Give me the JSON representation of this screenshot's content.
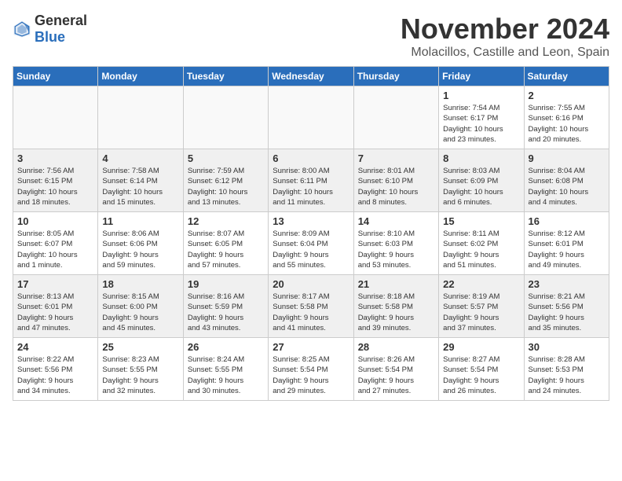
{
  "header": {
    "logo_general": "General",
    "logo_blue": "Blue",
    "month": "November 2024",
    "location": "Molacillos, Castille and Leon, Spain"
  },
  "weekdays": [
    "Sunday",
    "Monday",
    "Tuesday",
    "Wednesday",
    "Thursday",
    "Friday",
    "Saturday"
  ],
  "weeks": [
    [
      {
        "day": "",
        "info": "",
        "empty": true
      },
      {
        "day": "",
        "info": "",
        "empty": true
      },
      {
        "day": "",
        "info": "",
        "empty": true
      },
      {
        "day": "",
        "info": "",
        "empty": true
      },
      {
        "day": "",
        "info": "",
        "empty": true
      },
      {
        "day": "1",
        "info": "Sunrise: 7:54 AM\nSunset: 6:17 PM\nDaylight: 10 hours\nand 23 minutes.",
        "empty": false
      },
      {
        "day": "2",
        "info": "Sunrise: 7:55 AM\nSunset: 6:16 PM\nDaylight: 10 hours\nand 20 minutes.",
        "empty": false
      }
    ],
    [
      {
        "day": "3",
        "info": "Sunrise: 7:56 AM\nSunset: 6:15 PM\nDaylight: 10 hours\nand 18 minutes.",
        "empty": false
      },
      {
        "day": "4",
        "info": "Sunrise: 7:58 AM\nSunset: 6:14 PM\nDaylight: 10 hours\nand 15 minutes.",
        "empty": false
      },
      {
        "day": "5",
        "info": "Sunrise: 7:59 AM\nSunset: 6:12 PM\nDaylight: 10 hours\nand 13 minutes.",
        "empty": false
      },
      {
        "day": "6",
        "info": "Sunrise: 8:00 AM\nSunset: 6:11 PM\nDaylight: 10 hours\nand 11 minutes.",
        "empty": false
      },
      {
        "day": "7",
        "info": "Sunrise: 8:01 AM\nSunset: 6:10 PM\nDaylight: 10 hours\nand 8 minutes.",
        "empty": false
      },
      {
        "day": "8",
        "info": "Sunrise: 8:03 AM\nSunset: 6:09 PM\nDaylight: 10 hours\nand 6 minutes.",
        "empty": false
      },
      {
        "day": "9",
        "info": "Sunrise: 8:04 AM\nSunset: 6:08 PM\nDaylight: 10 hours\nand 4 minutes.",
        "empty": false
      }
    ],
    [
      {
        "day": "10",
        "info": "Sunrise: 8:05 AM\nSunset: 6:07 PM\nDaylight: 10 hours\nand 1 minute.",
        "empty": false
      },
      {
        "day": "11",
        "info": "Sunrise: 8:06 AM\nSunset: 6:06 PM\nDaylight: 9 hours\nand 59 minutes.",
        "empty": false
      },
      {
        "day": "12",
        "info": "Sunrise: 8:07 AM\nSunset: 6:05 PM\nDaylight: 9 hours\nand 57 minutes.",
        "empty": false
      },
      {
        "day": "13",
        "info": "Sunrise: 8:09 AM\nSunset: 6:04 PM\nDaylight: 9 hours\nand 55 minutes.",
        "empty": false
      },
      {
        "day": "14",
        "info": "Sunrise: 8:10 AM\nSunset: 6:03 PM\nDaylight: 9 hours\nand 53 minutes.",
        "empty": false
      },
      {
        "day": "15",
        "info": "Sunrise: 8:11 AM\nSunset: 6:02 PM\nDaylight: 9 hours\nand 51 minutes.",
        "empty": false
      },
      {
        "day": "16",
        "info": "Sunrise: 8:12 AM\nSunset: 6:01 PM\nDaylight: 9 hours\nand 49 minutes.",
        "empty": false
      }
    ],
    [
      {
        "day": "17",
        "info": "Sunrise: 8:13 AM\nSunset: 6:01 PM\nDaylight: 9 hours\nand 47 minutes.",
        "empty": false
      },
      {
        "day": "18",
        "info": "Sunrise: 8:15 AM\nSunset: 6:00 PM\nDaylight: 9 hours\nand 45 minutes.",
        "empty": false
      },
      {
        "day": "19",
        "info": "Sunrise: 8:16 AM\nSunset: 5:59 PM\nDaylight: 9 hours\nand 43 minutes.",
        "empty": false
      },
      {
        "day": "20",
        "info": "Sunrise: 8:17 AM\nSunset: 5:58 PM\nDaylight: 9 hours\nand 41 minutes.",
        "empty": false
      },
      {
        "day": "21",
        "info": "Sunrise: 8:18 AM\nSunset: 5:58 PM\nDaylight: 9 hours\nand 39 minutes.",
        "empty": false
      },
      {
        "day": "22",
        "info": "Sunrise: 8:19 AM\nSunset: 5:57 PM\nDaylight: 9 hours\nand 37 minutes.",
        "empty": false
      },
      {
        "day": "23",
        "info": "Sunrise: 8:21 AM\nSunset: 5:56 PM\nDaylight: 9 hours\nand 35 minutes.",
        "empty": false
      }
    ],
    [
      {
        "day": "24",
        "info": "Sunrise: 8:22 AM\nSunset: 5:56 PM\nDaylight: 9 hours\nand 34 minutes.",
        "empty": false
      },
      {
        "day": "25",
        "info": "Sunrise: 8:23 AM\nSunset: 5:55 PM\nDaylight: 9 hours\nand 32 minutes.",
        "empty": false
      },
      {
        "day": "26",
        "info": "Sunrise: 8:24 AM\nSunset: 5:55 PM\nDaylight: 9 hours\nand 30 minutes.",
        "empty": false
      },
      {
        "day": "27",
        "info": "Sunrise: 8:25 AM\nSunset: 5:54 PM\nDaylight: 9 hours\nand 29 minutes.",
        "empty": false
      },
      {
        "day": "28",
        "info": "Sunrise: 8:26 AM\nSunset: 5:54 PM\nDaylight: 9 hours\nand 27 minutes.",
        "empty": false
      },
      {
        "day": "29",
        "info": "Sunrise: 8:27 AM\nSunset: 5:54 PM\nDaylight: 9 hours\nand 26 minutes.",
        "empty": false
      },
      {
        "day": "30",
        "info": "Sunrise: 8:28 AM\nSunset: 5:53 PM\nDaylight: 9 hours\nand 24 minutes.",
        "empty": false
      }
    ]
  ]
}
